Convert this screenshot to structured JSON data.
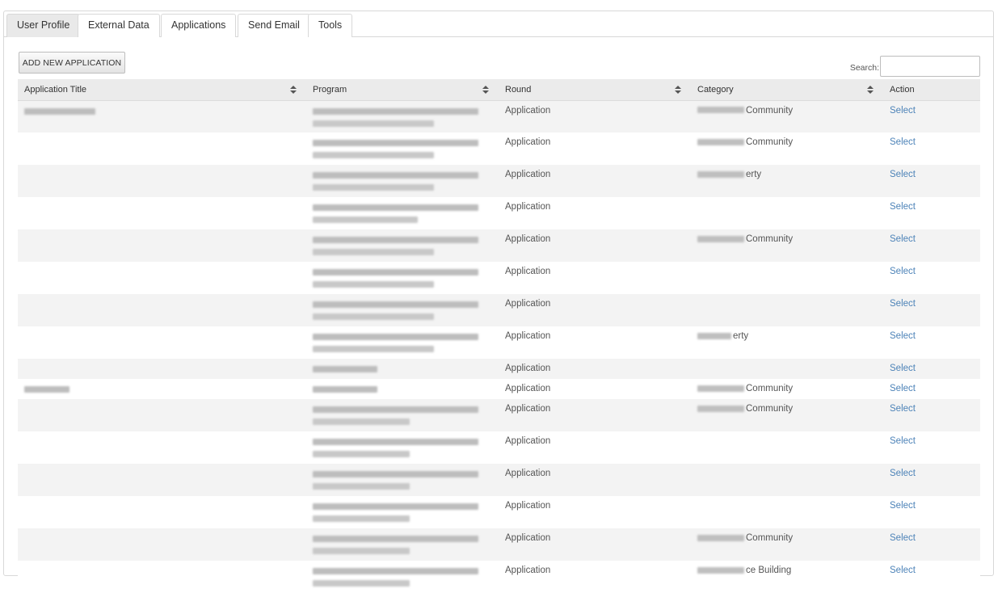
{
  "tabs": [
    {
      "label": "User Profile",
      "active": true
    },
    {
      "label": "External Data",
      "active": false
    },
    {
      "label": "Applications",
      "active": false
    },
    {
      "label": "Send Email",
      "active": false
    },
    {
      "label": "Tools",
      "active": false
    }
  ],
  "toolbar": {
    "add_label": "ADD NEW APPLICATION"
  },
  "search": {
    "label": "Search:",
    "value": ""
  },
  "table": {
    "headers": [
      "Application Title",
      "Program",
      "Round",
      "Category",
      "Action"
    ],
    "rows": [
      {
        "title_blurred": true,
        "program_lines": 2,
        "round": "Application",
        "category": "Community",
        "category_prefix_blurred": true,
        "action": "Select"
      },
      {
        "title_blurred": false,
        "program_lines": 2,
        "round": "Application",
        "category": "Community",
        "category_prefix_blurred": true,
        "action": "Select"
      },
      {
        "title_blurred": false,
        "program_lines": 2,
        "round": "Application",
        "category": "erty",
        "category_prefix_blurred": true,
        "action": "Select"
      },
      {
        "title_blurred": false,
        "program_lines": 2,
        "round": "Application",
        "category": "",
        "category_prefix_blurred": false,
        "action": "Select"
      },
      {
        "title_blurred": false,
        "program_lines": 2,
        "round": "Application",
        "category": "Community",
        "category_prefix_blurred": true,
        "action": "Select"
      },
      {
        "title_blurred": false,
        "program_lines": 2,
        "round": "Application",
        "category": "",
        "category_prefix_blurred": false,
        "action": "Select"
      },
      {
        "title_blurred": false,
        "program_lines": 2,
        "round": "Application",
        "category": "",
        "category_prefix_blurred": false,
        "action": "Select"
      },
      {
        "title_blurred": false,
        "program_lines": 2,
        "round": "Application",
        "category": "erty",
        "category_prefix_blurred": true,
        "action": "Select"
      },
      {
        "title_blurred": false,
        "program_lines": 1,
        "round": "Application",
        "category": "",
        "category_prefix_blurred": false,
        "action": "Select"
      },
      {
        "title_blurred": true,
        "program_lines": 1,
        "round": "Application",
        "category": "Community",
        "category_prefix_blurred": true,
        "action": "Select"
      },
      {
        "title_blurred": false,
        "program_lines": 2,
        "round": "Application",
        "category": "Community",
        "category_prefix_blurred": true,
        "action": "Select"
      },
      {
        "title_blurred": false,
        "program_lines": 2,
        "round": "Application",
        "category": "",
        "category_prefix_blurred": false,
        "action": "Select"
      },
      {
        "title_blurred": false,
        "program_lines": 2,
        "round": "Application",
        "category": "",
        "category_prefix_blurred": false,
        "action": "Select"
      },
      {
        "title_blurred": false,
        "program_lines": 2,
        "round": "Application",
        "category": "",
        "category_prefix_blurred": false,
        "action": "Select"
      },
      {
        "title_blurred": false,
        "program_lines": 2,
        "round": "Application",
        "category": "Community",
        "category_prefix_blurred": true,
        "action": "Select"
      },
      {
        "title_blurred": false,
        "program_lines": 2,
        "round": "Application",
        "category": "ce Building",
        "category_prefix_blurred": true,
        "action": "Select"
      }
    ]
  },
  "colors": {
    "link": "#4d83b8",
    "header_bg": "#ebebeb",
    "stripe": "#f3f3f3",
    "active_tab": "#e9e9e9"
  }
}
